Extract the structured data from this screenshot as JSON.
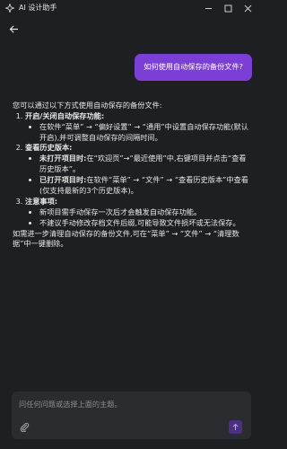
{
  "window": {
    "title": "AI 设计助手",
    "controls": {
      "minimize": "—",
      "maximize": "☐",
      "close": "✕"
    }
  },
  "chat": {
    "user_message": "如何使用自动保存的备份文件?",
    "answer": {
      "intro": "您可以通过以下方式使用自动保存的备份文件:",
      "sections": [
        {
          "title": "开启/关闭自动保存功能:",
          "items": [
            {
              "text": "在软件“菜单” → “偏好设置” → “通用”中设置自动保存功能(默认开启),并可调整自动保存的间隔时间。"
            }
          ]
        },
        {
          "title": "查看历史版本:",
          "items": [
            {
              "lead": "未打开项目时:",
              "text": "在“欢迎页”→“最近使用”中,右键项目并点击“查看历史版本”。"
            },
            {
              "lead": "已打开项目时:",
              "text": "在软件“菜单” → “文件” → “查看历史版本”中查看(仅支持最新的3个历史版本)。"
            }
          ]
        },
        {
          "title": "注意事项:",
          "items": [
            {
              "text": "新项目需手动保存一次后才会触发自动保存功能。"
            },
            {
              "text": "不建议手动修改存档文件后缀,可能导致文件损坏或无法保存。"
            }
          ]
        }
      ],
      "outro": "如需进一步清理自动保存的备份文件,可在“菜单” → “文件” → “清理数据”中一键删除。"
    }
  },
  "composer": {
    "placeholder": "问任何问题或选择上面的主题。"
  },
  "icons": {
    "app": "app-logo-icon",
    "back": "arrow-left-icon",
    "attach": "paperclip-icon",
    "send": "arrow-up-icon"
  },
  "colors": {
    "background": "#1e1f22",
    "user_bubble": "#7b3fd6",
    "input_bg": "#2b2c30",
    "send_button": "#4b2f80"
  }
}
